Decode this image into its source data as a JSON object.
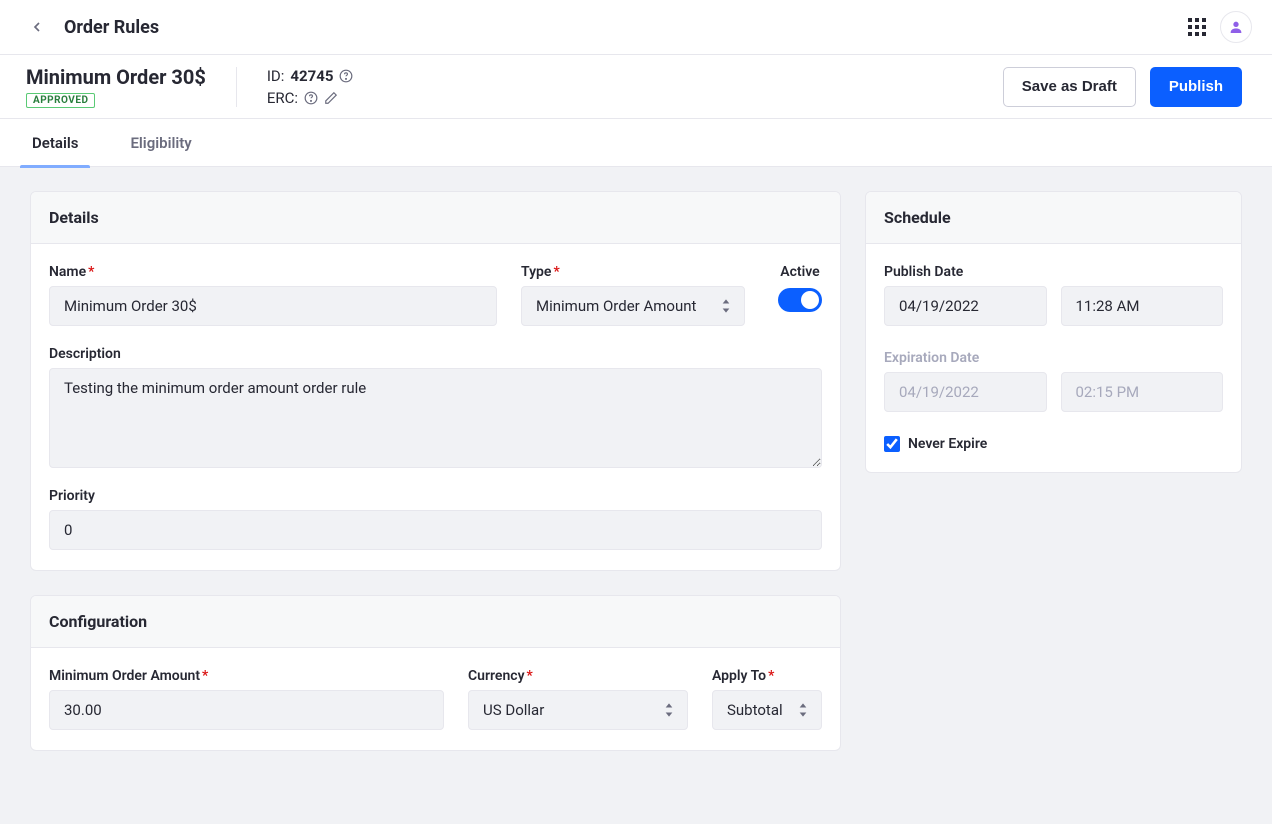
{
  "topbar": {
    "breadcrumb": "Order Rules"
  },
  "header": {
    "title": "Minimum Order 30$",
    "status": "APPROVED",
    "id_label": "ID:",
    "id_value": "42745",
    "erc_label": "ERC:",
    "save_draft": "Save as Draft",
    "publish": "Publish"
  },
  "tabs": {
    "details": "Details",
    "eligibility": "Eligibility"
  },
  "details_card": {
    "title": "Details",
    "name_label": "Name",
    "name_value": "Minimum Order 30$",
    "type_label": "Type",
    "type_value": "Minimum Order Amount",
    "active_label": "Active",
    "description_label": "Description",
    "description_value": "Testing the minimum order amount order rule",
    "priority_label": "Priority",
    "priority_value": "0"
  },
  "config_card": {
    "title": "Configuration",
    "min_label": "Minimum Order Amount",
    "min_value": "30.00",
    "currency_label": "Currency",
    "currency_value": "US Dollar",
    "apply_label": "Apply To",
    "apply_value": "Subtotal"
  },
  "schedule_card": {
    "title": "Schedule",
    "publish_label": "Publish Date",
    "publish_date": "04/19/2022",
    "publish_time": "11:28 AM",
    "expire_label": "Expiration Date",
    "expire_date": "04/19/2022",
    "expire_time": "02:15 PM",
    "never_expire": "Never Expire"
  }
}
